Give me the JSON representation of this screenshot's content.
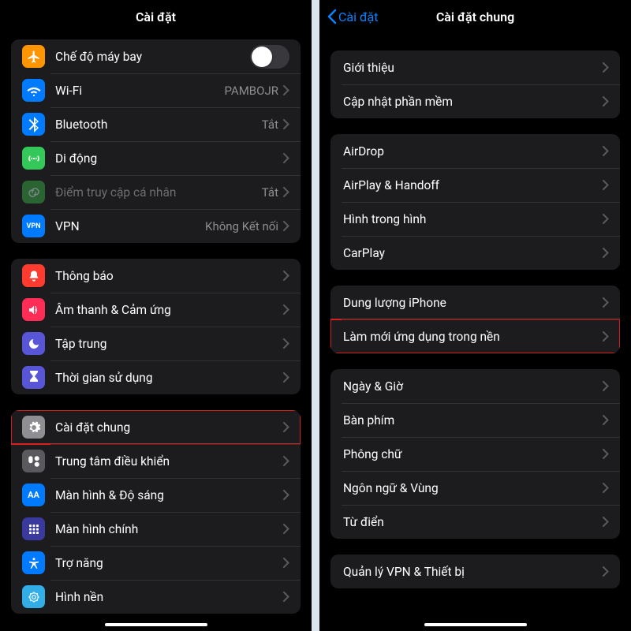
{
  "left": {
    "title": "Cài đặt",
    "g1": {
      "airplane": "Chế độ máy bay",
      "wifi": "Wi-Fi",
      "wifi_val": "PAMBOJR",
      "bluetooth": "Bluetooth",
      "bluetooth_val": "Tắt",
      "cellular": "Di động",
      "hotspot": "Điểm truy cập cá nhân",
      "hotspot_val": "Tắt",
      "vpn": "VPN",
      "vpn_val": "Không Kết nối"
    },
    "g2": {
      "notifications": "Thông báo",
      "sounds": "Âm thanh & Cảm ứng",
      "focus": "Tập trung",
      "screentime": "Thời gian sử dụng"
    },
    "g3": {
      "general": "Cài đặt chung",
      "controlcenter": "Trung tâm điều khiển",
      "display": "Màn hình & Độ sáng",
      "homescreen": "Màn hình chính",
      "accessibility": "Trợ năng",
      "wallpaper": "Hình nền"
    }
  },
  "right": {
    "back": "Cài đặt",
    "title": "Cài đặt chung",
    "g1": {
      "about": "Giới thiệu",
      "software": "Cập nhật phần mềm"
    },
    "g2": {
      "airdrop": "AirDrop",
      "airplay": "AirPlay & Handoff",
      "pip": "Hình trong hình",
      "carplay": "CarPlay"
    },
    "g3": {
      "storage": "Dung lượng iPhone",
      "bgrefresh": "Làm mới ứng dụng trong nền"
    },
    "g4": {
      "datetime": "Ngày & Giờ",
      "keyboard": "Bàn phím",
      "fonts": "Phông chữ",
      "language": "Ngôn ngữ & Vùng",
      "dictionary": "Từ điển"
    },
    "g5": {
      "vpndevice": "Quản lý VPN & Thiết bị"
    }
  }
}
